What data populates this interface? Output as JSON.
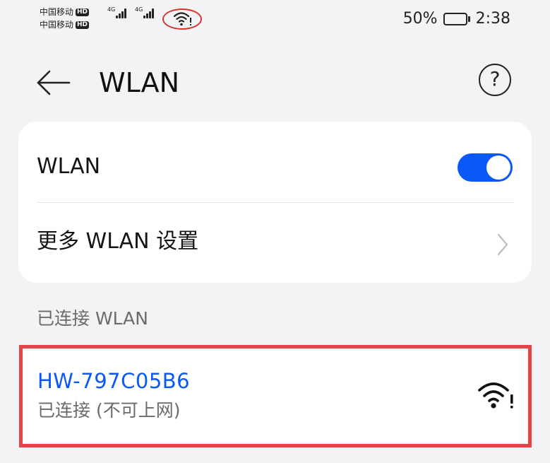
{
  "status_bar": {
    "carrier_1": "中国移动",
    "carrier_2": "中国移动",
    "hd_badge": "HD",
    "network_type_1": "4G",
    "network_type_2": "4G",
    "battery_percent": "50%",
    "battery_level": 0.5,
    "time": "2:38",
    "annotation_color": "#d9342b"
  },
  "header": {
    "title": "WLAN"
  },
  "settings": {
    "wlan_label": "WLAN",
    "wlan_enabled": true,
    "more_settings_label": "更多 WLAN 设置"
  },
  "connected_section": {
    "header": "已连接 WLAN",
    "network": {
      "ssid": "HW-797C05B6",
      "status": "已连接 (不可上网)",
      "signal_icon": "wifi-no-internet-icon"
    },
    "highlight_color": "#e04647"
  },
  "colors": {
    "accent": "#0a59f7",
    "background": "#f1f3f5"
  }
}
